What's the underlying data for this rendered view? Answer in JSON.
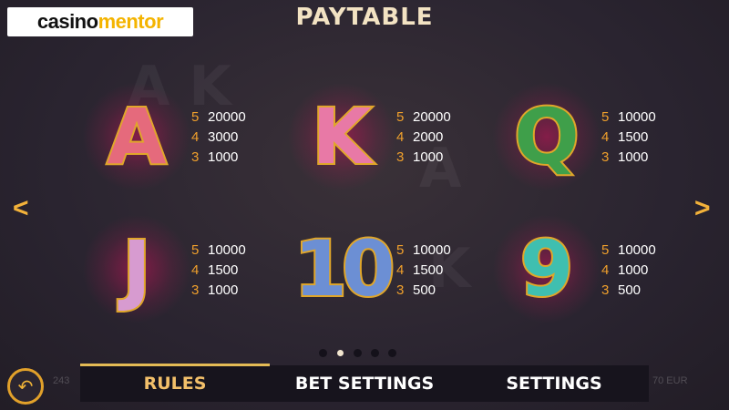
{
  "logo": {
    "part1": "casino",
    "part2": "mentor"
  },
  "title": "PAYTABLE",
  "symbols": [
    {
      "glyph": "A",
      "fill": "#e56a7c",
      "pays": [
        {
          "count": "5",
          "value": "20000"
        },
        {
          "count": "4",
          "value": "3000"
        },
        {
          "count": "3",
          "value": "1000"
        }
      ]
    },
    {
      "glyph": "K",
      "fill": "#e879a6",
      "pays": [
        {
          "count": "5",
          "value": "20000"
        },
        {
          "count": "4",
          "value": "2000"
        },
        {
          "count": "3",
          "value": "1000"
        }
      ]
    },
    {
      "glyph": "Q",
      "fill": "#3f9f4a",
      "pays": [
        {
          "count": "5",
          "value": "10000"
        },
        {
          "count": "4",
          "value": "1500"
        },
        {
          "count": "3",
          "value": "1000"
        }
      ]
    },
    {
      "glyph": "J",
      "fill": "#d79bd0",
      "pays": [
        {
          "count": "5",
          "value": "10000"
        },
        {
          "count": "4",
          "value": "1500"
        },
        {
          "count": "3",
          "value": "1000"
        }
      ]
    },
    {
      "glyph": "10",
      "fill": "#6c8fd4",
      "pays": [
        {
          "count": "5",
          "value": "10000"
        },
        {
          "count": "4",
          "value": "1500"
        },
        {
          "count": "3",
          "value": "500"
        }
      ]
    },
    {
      "glyph": "9",
      "fill": "#3fbfb0",
      "pays": [
        {
          "count": "5",
          "value": "10000"
        },
        {
          "count": "4",
          "value": "1000"
        },
        {
          "count": "3",
          "value": "500"
        }
      ]
    }
  ],
  "nav": {
    "prev_icon": "chevron-left-icon",
    "next_icon": "chevron-right-icon",
    "prev": "<",
    "next": ">"
  },
  "pager": {
    "total": 5,
    "active_index": 1
  },
  "back_icon": "back-arrow-icon",
  "back_glyph": "↶",
  "tabs": [
    {
      "label": "RULES",
      "active": true
    },
    {
      "label": "BET SETTINGS",
      "active": false
    },
    {
      "label": "SETTINGS",
      "active": false
    }
  ],
  "background": {
    "left_box": "243",
    "right_box": "70 EUR"
  },
  "colors": {
    "accent": "#e2a12a",
    "count": "#f0a02c",
    "tab_active": "#f3c06a"
  }
}
